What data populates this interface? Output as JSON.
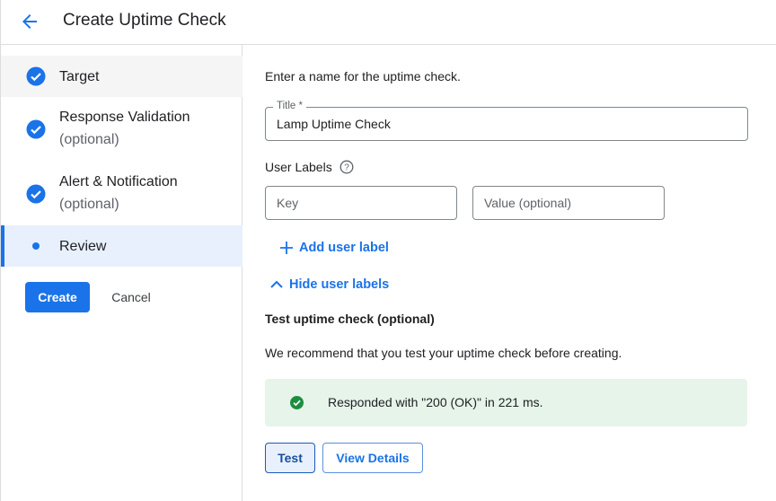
{
  "header": {
    "title": "Create Uptime Check",
    "back_icon": "arrow-left-icon"
  },
  "steps": [
    {
      "label": "Target",
      "optional": "",
      "status": "complete"
    },
    {
      "label": "Response Validation",
      "optional": "(optional)",
      "status": "complete"
    },
    {
      "label": "Alert & Notification",
      "optional": "(optional)",
      "status": "complete"
    },
    {
      "label": "Review",
      "optional": "",
      "status": "current"
    }
  ],
  "actions": {
    "create": "Create",
    "cancel": "Cancel"
  },
  "form": {
    "intro": "Enter a name for the uptime check.",
    "title_label": "Title *",
    "title_value": "Lamp Uptime Check",
    "user_labels_heading": "User Labels",
    "key_placeholder": "Key",
    "value_placeholder": "Value (optional)",
    "add_user_label": "Add user label",
    "hide_user_labels": "Hide user labels",
    "test_heading": "Test uptime check (optional)",
    "test_recommend": "We recommend that you test your uptime check before creating.",
    "test_result": "Responded with \"200 (OK)\" in 221 ms.",
    "test_button": "Test",
    "view_details_button": "View Details"
  },
  "colors": {
    "accent": "#1a73e8",
    "success": "#1e8e3e",
    "success_bg": "#e6f4ea",
    "selected_bg": "#e8f0fe"
  }
}
